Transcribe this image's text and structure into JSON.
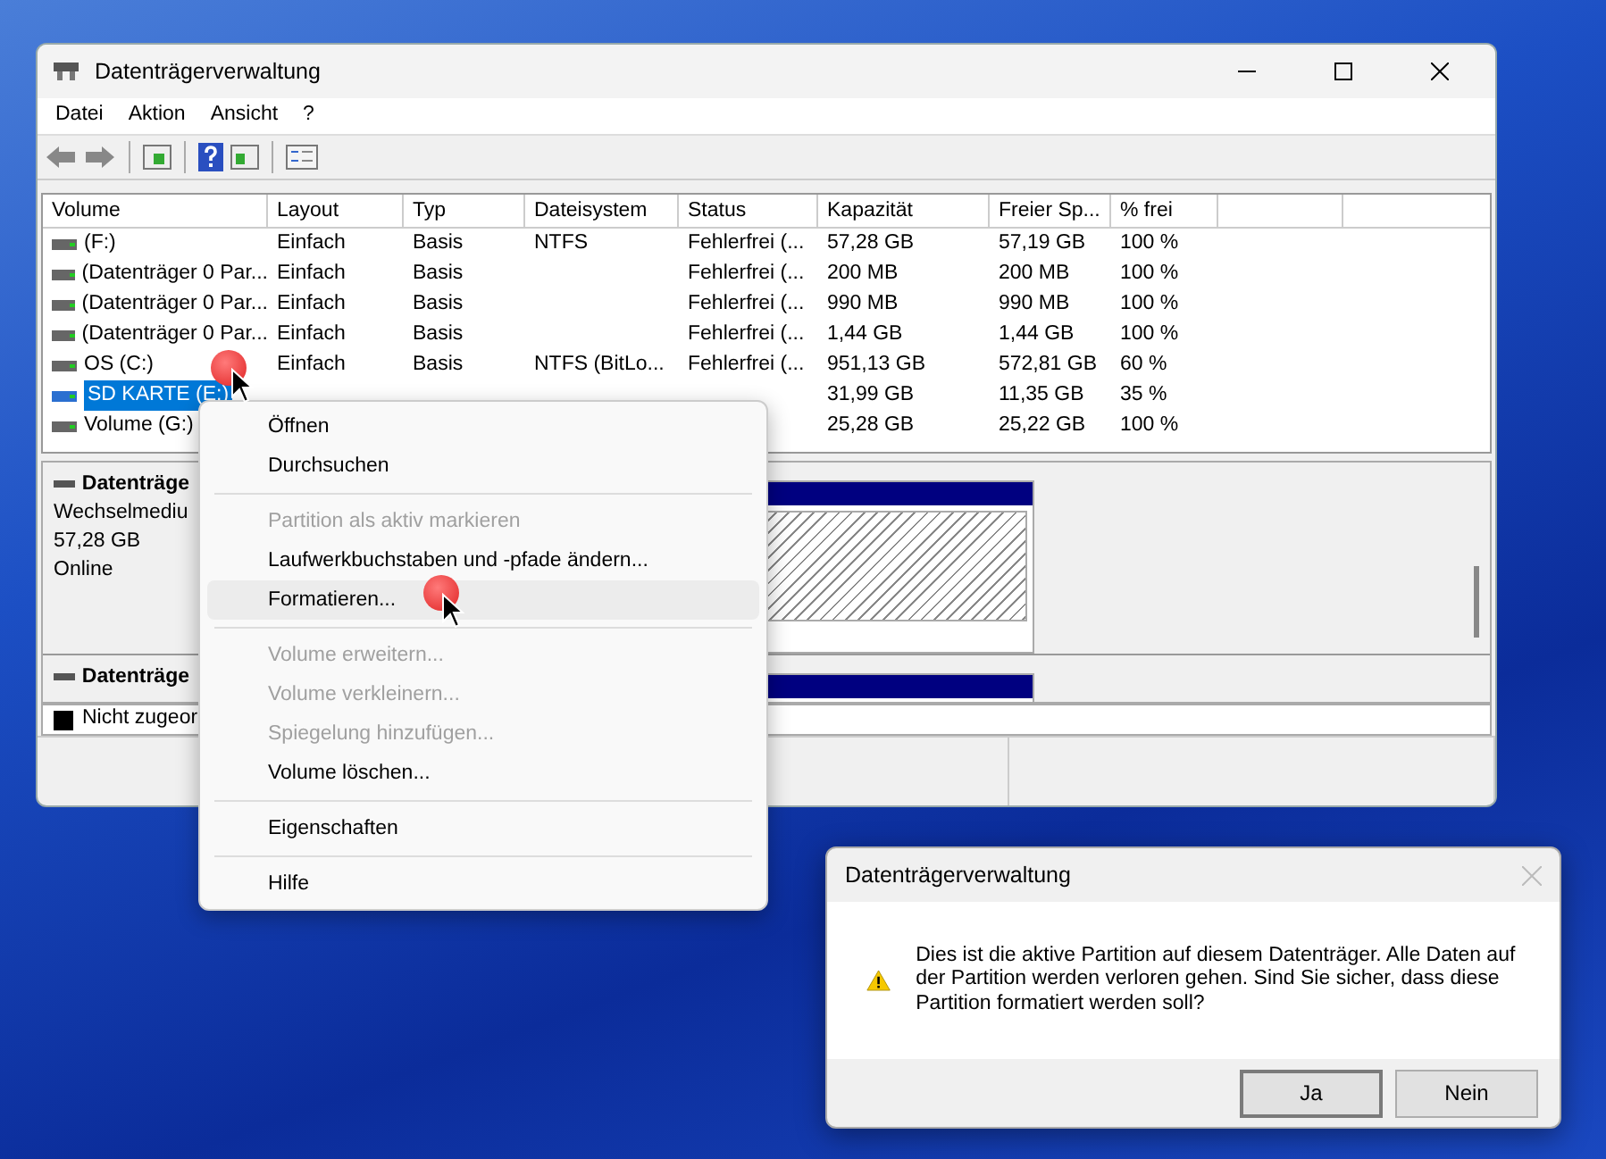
{
  "window": {
    "title": "Datenträgerverwaltung"
  },
  "menu_bar": [
    "Datei",
    "Aktion",
    "Ansicht",
    "?"
  ],
  "volume_table": {
    "columns": [
      "Volume",
      "Layout",
      "Typ",
      "Dateisystem",
      "Status",
      "Kapazität",
      "Freier Sp...",
      "% frei"
    ],
    "rows": [
      {
        "cells": [
          "(F:)",
          "Einfach",
          "Basis",
          "NTFS",
          "Fehlerfrei (...",
          "57,28 GB",
          "57,19 GB",
          "100 %"
        ],
        "selected": false
      },
      {
        "cells": [
          "(Datenträger 0 Par...",
          "Einfach",
          "Basis",
          "",
          "Fehlerfrei (...",
          "200 MB",
          "200 MB",
          "100 %"
        ],
        "selected": false
      },
      {
        "cells": [
          "(Datenträger 0 Par...",
          "Einfach",
          "Basis",
          "",
          "Fehlerfrei (...",
          "990 MB",
          "990 MB",
          "100 %"
        ],
        "selected": false
      },
      {
        "cells": [
          "(Datenträger 0 Par...",
          "Einfach",
          "Basis",
          "",
          "Fehlerfrei (...",
          "1,44 GB",
          "1,44 GB",
          "100 %"
        ],
        "selected": false
      },
      {
        "cells": [
          "OS (C:)",
          "Einfach",
          "Basis",
          "NTFS (BitLo...",
          "Fehlerfrei (...",
          "951,13 GB",
          "572,81 GB",
          "60 %"
        ],
        "selected": false
      },
      {
        "cells": [
          "SD KARTE (E:)",
          "",
          "",
          "",
          "",
          "31,99 GB",
          "11,35 GB",
          "35 %"
        ],
        "selected": true
      },
      {
        "cells": [
          "Volume (G:)",
          "",
          "",
          "",
          "",
          "25,28 GB",
          "25,22 GB",
          "100 %"
        ],
        "selected": false
      }
    ]
  },
  "disks": [
    {
      "name": "Datenträge",
      "lines": [
        "Wechselmediu",
        "57,28 GB",
        "Online"
      ]
    },
    {
      "name": "Datenträge"
    }
  ],
  "legend": [
    {
      "label": "Nicht zugeor",
      "color": "#000000"
    }
  ],
  "context_menu": [
    {
      "kind": "item",
      "label": "Öffnen",
      "disabled": false,
      "highlighted": false
    },
    {
      "kind": "item",
      "label": "Durchsuchen",
      "disabled": false,
      "highlighted": false
    },
    {
      "kind": "separator"
    },
    {
      "kind": "item",
      "label": "Partition als aktiv markieren",
      "disabled": true,
      "highlighted": false
    },
    {
      "kind": "item",
      "label": "Laufwerkbuchstaben und -pfade ändern...",
      "disabled": false,
      "highlighted": false
    },
    {
      "kind": "item",
      "label": "Formatieren...",
      "disabled": false,
      "highlighted": true
    },
    {
      "kind": "separator"
    },
    {
      "kind": "item",
      "label": "Volume erweitern...",
      "disabled": true,
      "highlighted": false
    },
    {
      "kind": "item",
      "label": "Volume verkleinern...",
      "disabled": true,
      "highlighted": false
    },
    {
      "kind": "item",
      "label": "Spiegelung hinzufügen...",
      "disabled": true,
      "highlighted": false
    },
    {
      "kind": "item",
      "label": "Volume löschen...",
      "disabled": false,
      "highlighted": false
    },
    {
      "kind": "separator"
    },
    {
      "kind": "item",
      "label": "Eigenschaften",
      "disabled": false,
      "highlighted": false
    },
    {
      "kind": "separator"
    },
    {
      "kind": "item",
      "label": "Hilfe",
      "disabled": false,
      "highlighted": false
    }
  ],
  "dialog": {
    "title": "Datenträgerverwaltung",
    "message": "Dies ist die aktive Partition auf diesem Datenträger. Alle Daten auf der Partition werden verloren gehen. Sind Sie sicher, dass diese Partition formatiert werden soll?",
    "buttons": [
      {
        "label": "Ja",
        "default": true
      },
      {
        "label": "Nein",
        "default": false
      }
    ]
  }
}
